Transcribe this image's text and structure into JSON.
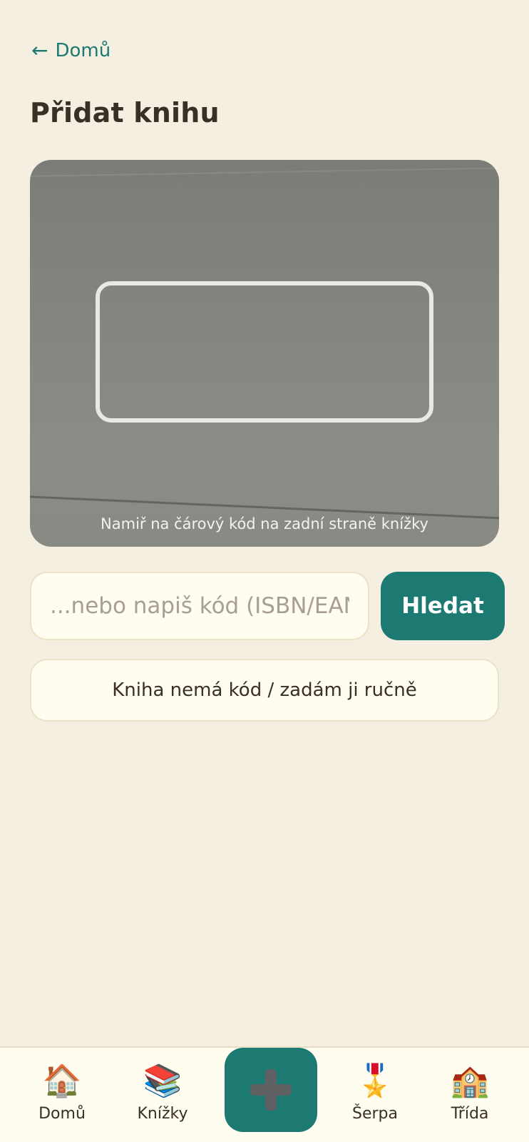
{
  "header": {
    "back_arrow": "←",
    "back_label": "Domů",
    "title": "Přidat knihu"
  },
  "scanner": {
    "hint": "Namiř na čárový kód na zadní straně knížky"
  },
  "search": {
    "placeholder": "...nebo napiš kód (ISBN/EAN)",
    "value": "",
    "button_label": "Hledat"
  },
  "manual": {
    "label": "Kniha nemá kód / zadám ji ručně"
  },
  "nav": {
    "items": [
      {
        "label": "Domů",
        "icon": "🏠",
        "icon_name": "house-icon"
      },
      {
        "label": "Knížky",
        "icon": "📚",
        "icon_name": "books-icon"
      },
      {
        "label": "",
        "icon_name": "plus-icon"
      },
      {
        "label": "Šerpa",
        "icon": "🎖️",
        "icon_name": "medal-icon"
      },
      {
        "label": "Třída",
        "icon": "🏫",
        "icon_name": "school-icon"
      }
    ]
  },
  "colors": {
    "background": "#f4efe0",
    "accent": "#1c7a72",
    "surface": "#fffcf0",
    "text": "#3a2f25"
  }
}
